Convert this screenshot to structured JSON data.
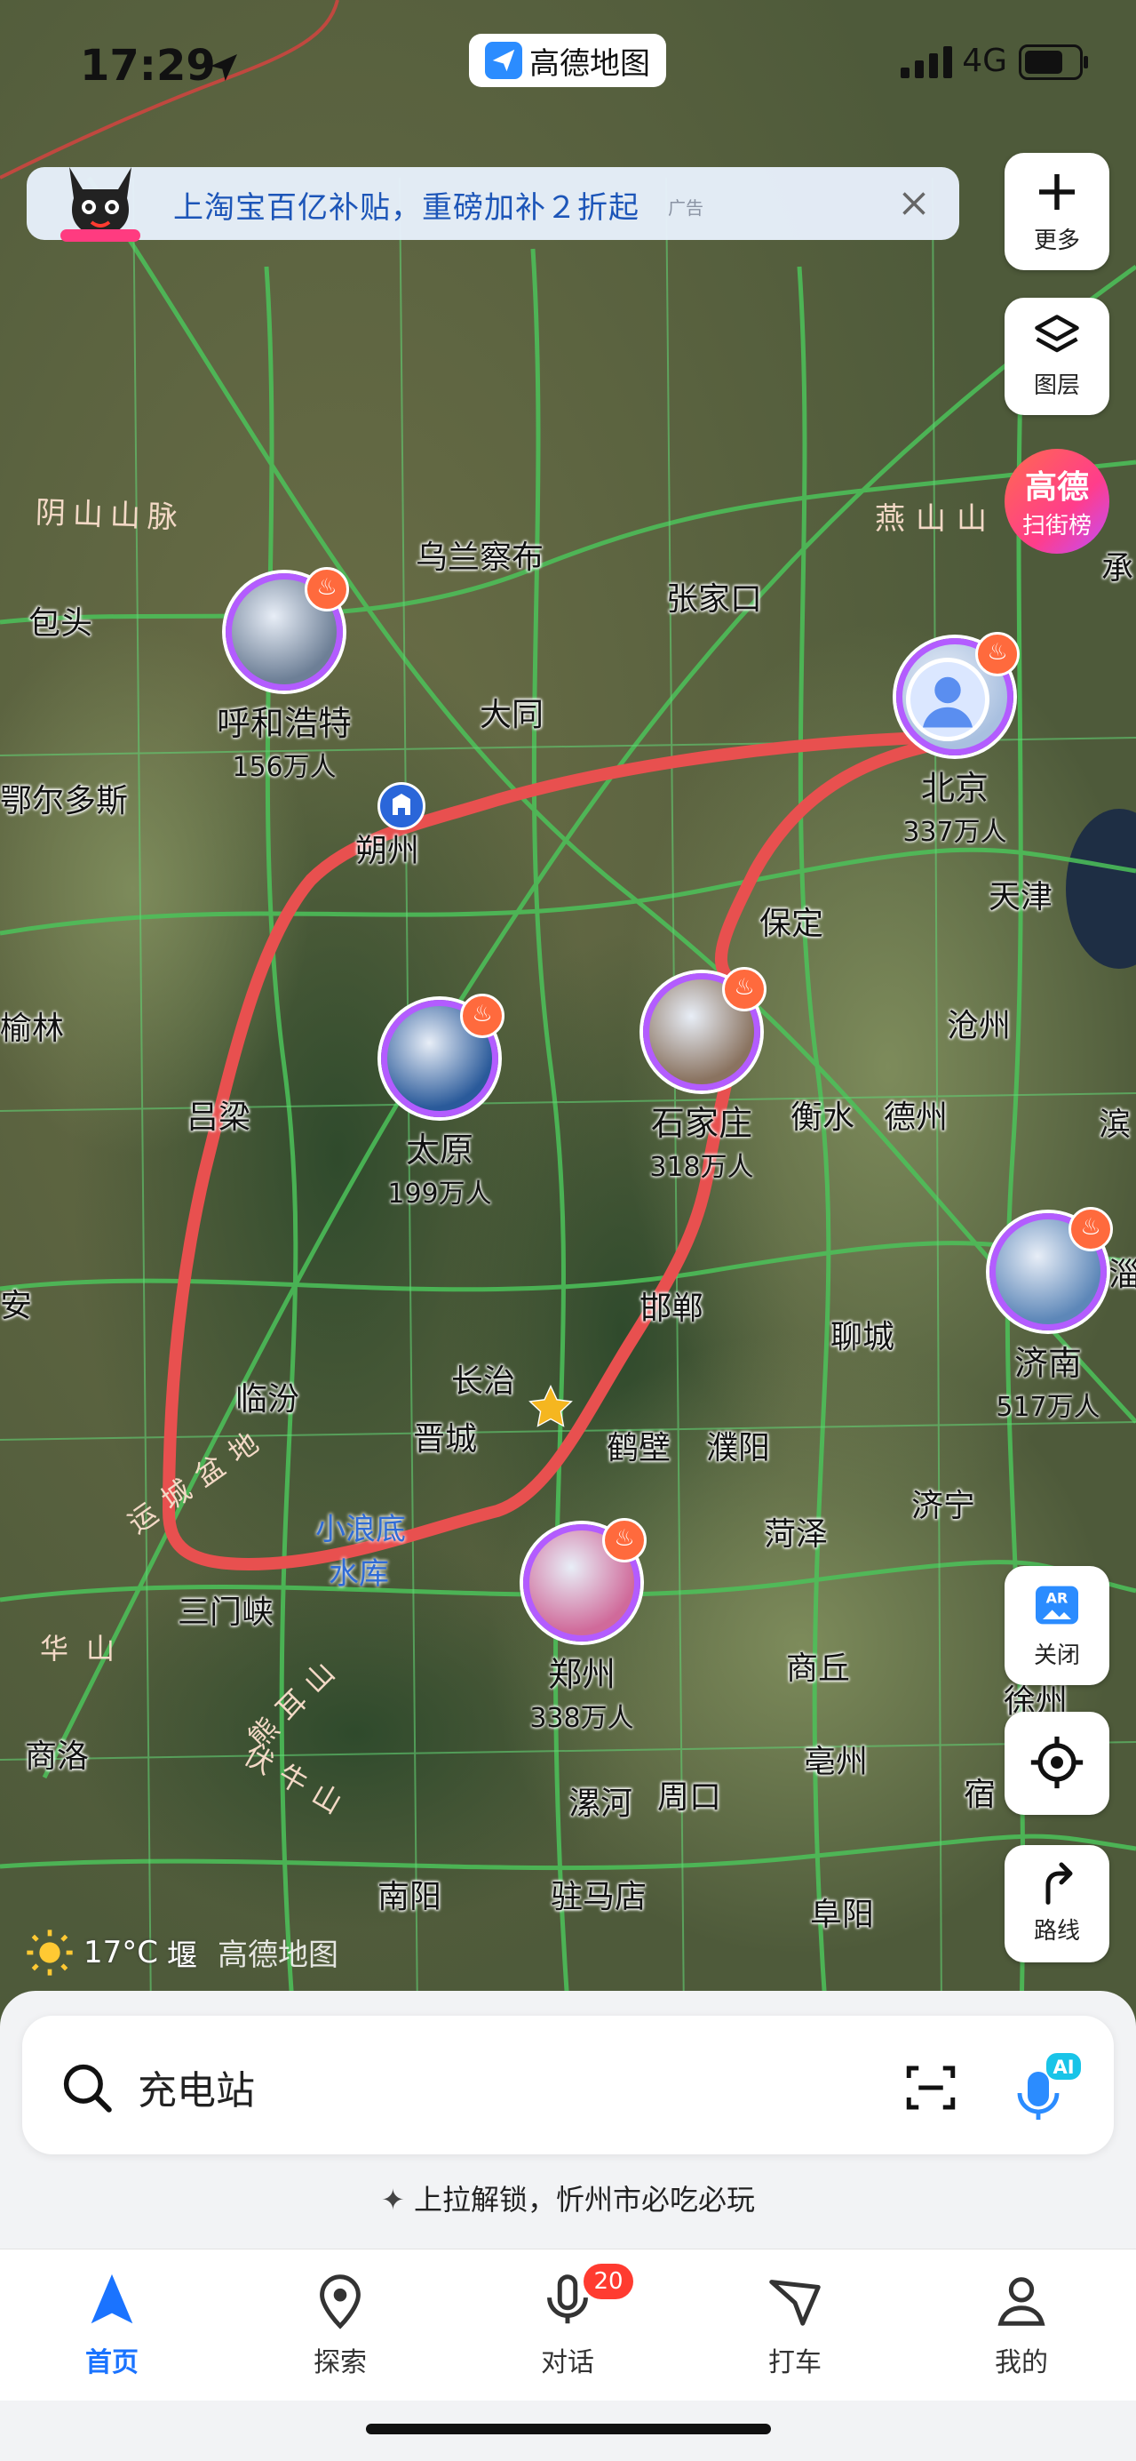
{
  "status_bar": {
    "time": "17:29",
    "app_name": "高德地图",
    "network": "4G"
  },
  "ad_banner": {
    "text": "上淘宝百亿补贴，重磅加补２折起",
    "tag": "广告"
  },
  "side_buttons": {
    "more": "更多",
    "layers": "图层",
    "ar_close": "关闭",
    "route": "路线"
  },
  "ranking_badge": {
    "line1": "高德",
    "line2": "扫街榜"
  },
  "map": {
    "colors": {
      "route_line": "#e8504f",
      "road": "#4cc35a",
      "accent": "#1a73ff"
    },
    "terrain_labels": [
      "阴山山脉",
      "燕山山",
      "运城盆地",
      "熊耳山",
      "伏牛山",
      "华山",
      "小浪底",
      "水库"
    ],
    "city_labels": [
      "乌兰察布",
      "张家口",
      "包头",
      "大同",
      "鄂尔多斯",
      "朔州",
      "保定",
      "天津",
      "沧州",
      "榆林",
      "吕梁",
      "衡水",
      "德州",
      "滨",
      "邯郸",
      "聊城",
      "淄",
      "安",
      "临汾",
      "长治",
      "晋城",
      "鹤壁",
      "濮阳",
      "济宁",
      "三门峡",
      "菏泽",
      "徐州",
      "商丘",
      "商洛",
      "亳州",
      "漯河",
      "周口",
      "宿",
      "南阳",
      "驻马店",
      "阜阳",
      "承"
    ],
    "hot_cities": [
      {
        "name": "呼和浩特",
        "population": "156万人"
      },
      {
        "name": "北京",
        "population": "337万人"
      },
      {
        "name": "太原",
        "population": "199万人"
      },
      {
        "name": "石家庄",
        "population": "318万人"
      },
      {
        "name": "济南",
        "population": "517万人"
      },
      {
        "name": "郑州",
        "population": "338万人"
      }
    ]
  },
  "weather": {
    "temperature": "17°C",
    "city_suffix": "堰",
    "watermark": "高德地图"
  },
  "search": {
    "placeholder": "充电站",
    "ai_label": "AI"
  },
  "hint": "上拉解锁，忻州市必吃必玩",
  "tabs": [
    {
      "label": "首页",
      "icon": "navigation-arrow-icon",
      "active": true
    },
    {
      "label": "探索",
      "icon": "location-pin-icon"
    },
    {
      "label": "对话",
      "icon": "microphone-icon",
      "badge": "20"
    },
    {
      "label": "打车",
      "icon": "taxi-arrow-icon"
    },
    {
      "label": "我的",
      "icon": "person-icon"
    }
  ]
}
